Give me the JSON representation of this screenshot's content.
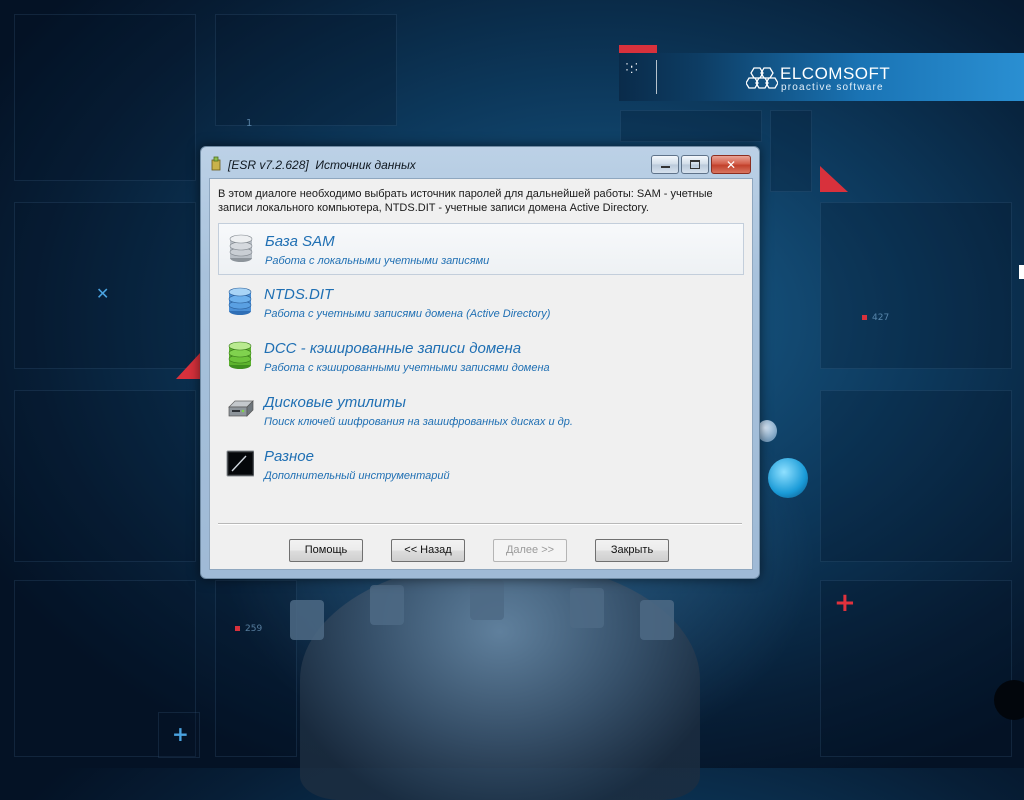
{
  "desktop": {
    "deco_numbers": [
      "1",
      "427",
      "259"
    ]
  },
  "banner": {
    "brand_name": "ELCOMSOFT",
    "tagline": "proactive software",
    "accent_color": "#d8313c"
  },
  "window": {
    "title_version": "[ESR v7.2.628]",
    "title_name": "Источник данных",
    "controls": [
      "minimize-icon",
      "maximize-icon",
      "close-icon"
    ],
    "intro_text": "В этом диалоге необходимо выбрать источник паролей для дальнейшей работы: SAM - учетные записи локального компьютера, NTDS.DIT - учетные записи домена Active Directory.",
    "options": [
      {
        "title": "База SAM",
        "desc": "Работа с локальными учетными записями",
        "icon": "database-gray-icon",
        "selected": true
      },
      {
        "title": "NTDS.DIT",
        "desc": "Работа с учетными записями домена (Active Directory)",
        "icon": "database-blue-icon",
        "selected": false
      },
      {
        "title": "DCC - кэшированные записи домена",
        "desc": "Работа с кэшированными учетными записями домена",
        "icon": "database-green-icon",
        "selected": false
      },
      {
        "title": "Дисковые утилиты",
        "desc": "Поиск ключей шифрования на зашифрованных дисках и др.",
        "icon": "disk-drive-icon",
        "selected": false
      },
      {
        "title": "Разное",
        "desc": "Дополнительный инструментарий",
        "icon": "terminal-icon",
        "selected": false
      }
    ],
    "buttons": {
      "help": "Помощь",
      "back": "<< Назад",
      "next": "Далее >>",
      "close": "Закрыть"
    },
    "option_color": "#1f6fb3"
  }
}
